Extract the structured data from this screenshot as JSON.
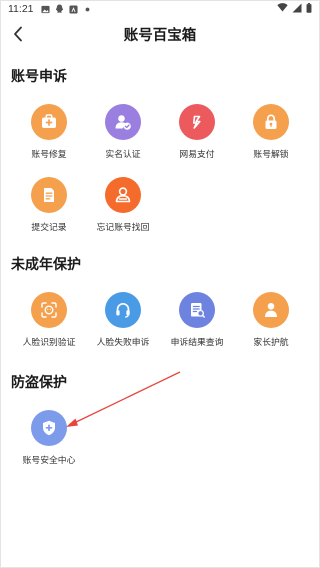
{
  "status_bar": {
    "time": "11:21"
  },
  "header": {
    "title": "账号百宝箱"
  },
  "sections": {
    "appeal": {
      "title": "账号申诉",
      "items": [
        "账号修复",
        "实名认证",
        "网易支付",
        "账号解锁",
        "提交记录",
        "忘记账号找回"
      ]
    },
    "minor": {
      "title": "未成年保护",
      "items": [
        "人脸识别验证",
        "人脸失败申诉",
        "申诉结果查询",
        "家长护航"
      ]
    },
    "antitheft": {
      "title": "防盗保护",
      "items": [
        "账号安全中心"
      ]
    }
  },
  "colors": {
    "orange": "#F5A04D",
    "purple": "#9B7FE0",
    "red": "#EC5A5E",
    "deep_orange": "#F46B2C",
    "blue": "#4A9BE6",
    "indigo": "#6E82E0",
    "periwinkle": "#7C9BEB",
    "arrow": "#E8453C"
  }
}
